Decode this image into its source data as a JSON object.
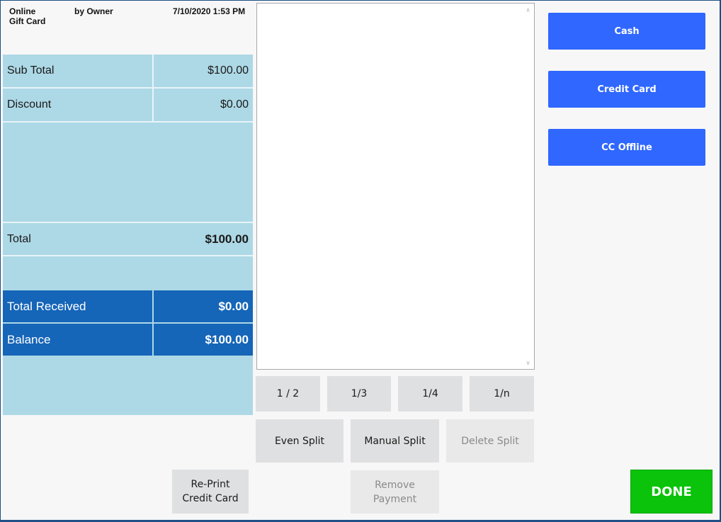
{
  "header": {
    "line1": "Online",
    "line2": "Gift Card",
    "by": "by Owner",
    "datetime": "7/10/2020 1:53 PM"
  },
  "summary": {
    "subtotal_label": "Sub Total",
    "subtotal_value": "$100.00",
    "discount_label": "Discount",
    "discount_value": "$0.00",
    "total_label": "Total",
    "total_value": "$100.00",
    "received_label": "Total Received",
    "received_value": "$0.00",
    "balance_label": "Balance",
    "balance_value": "$100.00"
  },
  "splits": {
    "half": "1 / 2",
    "third": "1/3",
    "quarter": "1/4",
    "nth": "1/n",
    "even": "Even Split",
    "manual": "Manual Split",
    "delete": "Delete Split"
  },
  "actions": {
    "reprint_line1": "Re-Print",
    "reprint_line2": "Credit Card",
    "remove_line1": "Remove",
    "remove_line2": "Payment",
    "done": "DONE"
  },
  "payment_methods": {
    "cash": "Cash",
    "credit_card": "Credit Card",
    "cc_offline": "CC Offline"
  },
  "colors": {
    "accent_blue": "#2f67ff",
    "summary_bg": "#add8e6",
    "balance_bg": "#1565b8",
    "done_green": "#0ac30a"
  }
}
